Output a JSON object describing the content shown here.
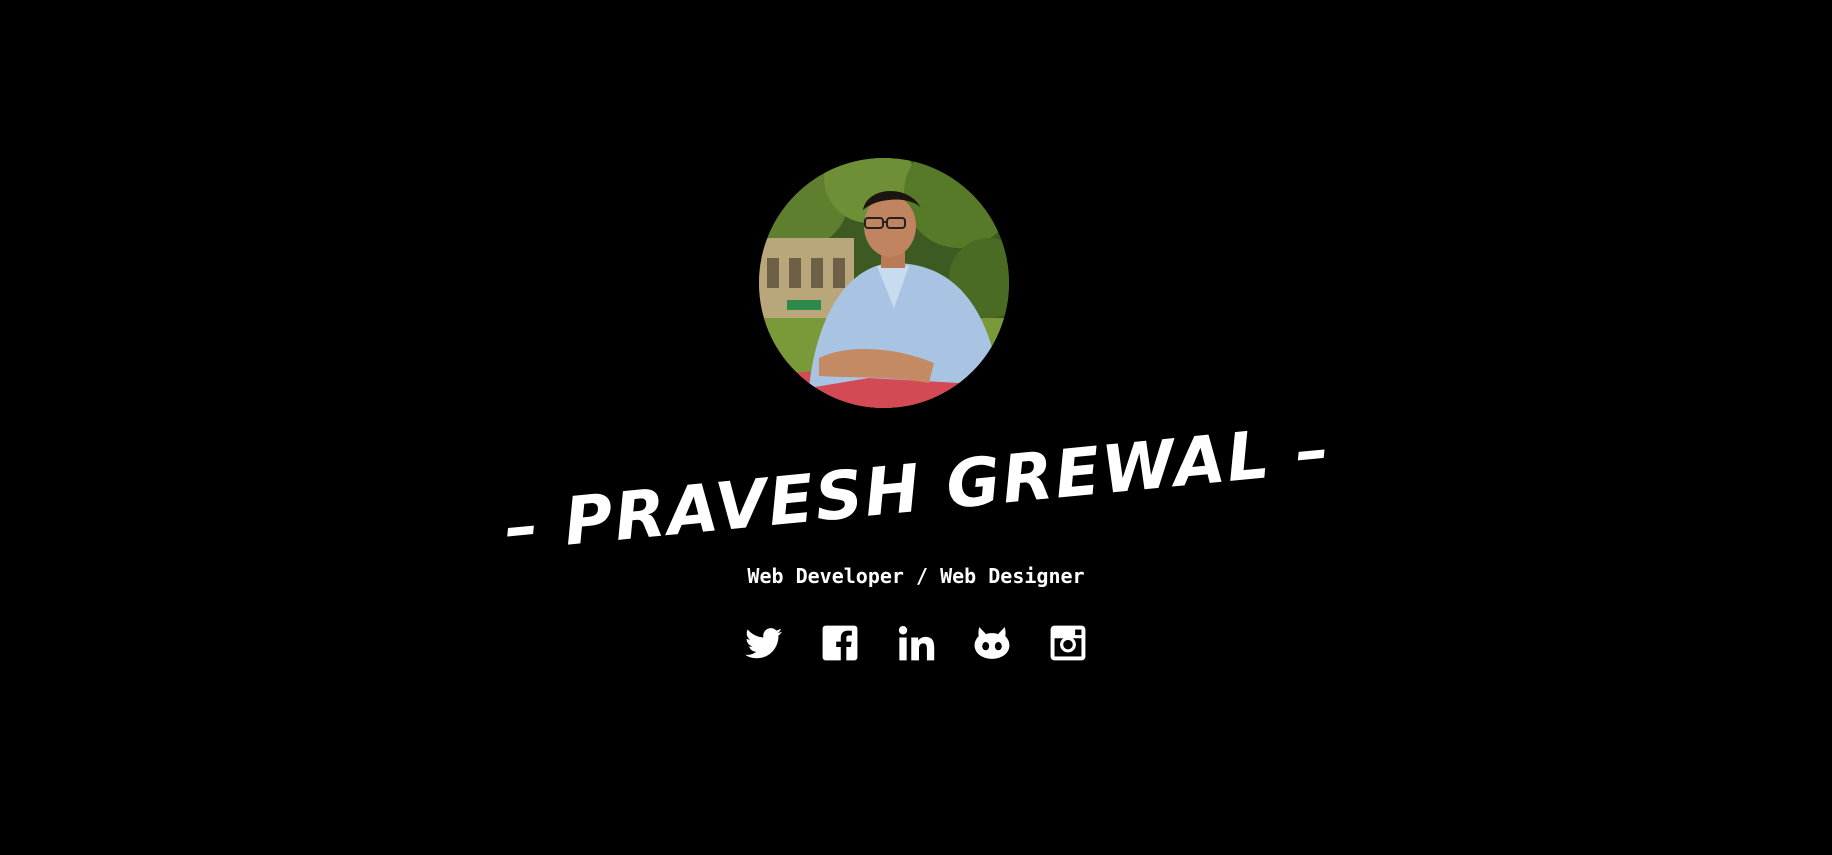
{
  "profile": {
    "name": "– PRAVESH GREWAL –",
    "subtitle": "Web Developer / Web Designer"
  },
  "socials": [
    {
      "icon": "twitter-icon"
    },
    {
      "icon": "facebook-icon"
    },
    {
      "icon": "linkedin-icon"
    },
    {
      "icon": "github-icon"
    },
    {
      "icon": "instagram-icon"
    }
  ],
  "colors": {
    "background": "#000000",
    "text": "#ffffff"
  }
}
